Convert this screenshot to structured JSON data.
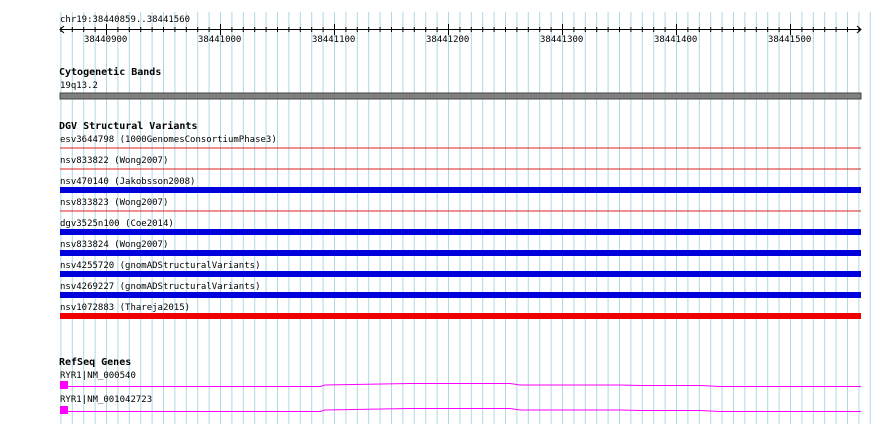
{
  "ruler": {
    "location": "chr19:38440859..38441560",
    "ticks": [
      "38440900",
      "38441000",
      "38441100",
      "38441200",
      "38441300",
      "38441400",
      "38441500"
    ]
  },
  "cytoband": {
    "title": "Cytogenetic Bands",
    "band": "19q13.2",
    "color": "#808080"
  },
  "dgv": {
    "title": "DGV Structural Variants",
    "variants": [
      {
        "label": "esv3644798 (1000GenomesConsortiumPhase3)",
        "color": "#dd2222",
        "type": "thin"
      },
      {
        "label": "nsv833822 (Wong2007)",
        "color": "#dd2222",
        "type": "thin"
      },
      {
        "label": "nsv470140 (Jakobsson2008)",
        "color": "#0000dd",
        "type": "thick"
      },
      {
        "label": "nsv833823 (Wong2007)",
        "color": "#dd2222",
        "type": "thin"
      },
      {
        "label": "dgv3525n100 (Coe2014)",
        "color": "#0000dd",
        "type": "thick"
      },
      {
        "label": "nsv833824 (Wong2007)",
        "color": "#0000dd",
        "type": "thick"
      },
      {
        "label": "nsv4255720 (gnomADStructuralVariants)",
        "color": "#0000dd",
        "type": "thick"
      },
      {
        "label": "nsv4269227 (gnomADStructuralVariants)",
        "color": "#0000dd",
        "type": "thick"
      },
      {
        "label": "nsv1072883 (Thareja2015)",
        "color": "#ee0000",
        "type": "thick"
      }
    ]
  },
  "refseq": {
    "title": "RefSeq Genes",
    "genes": [
      {
        "label": "RYR1|NM_000540",
        "color": "#ff00ff"
      },
      {
        "label": "RYR1|NM_001042723",
        "color": "#ff00ff"
      }
    ]
  },
  "colors": {
    "grid": "#add8e6",
    "ruler": "#000000"
  }
}
